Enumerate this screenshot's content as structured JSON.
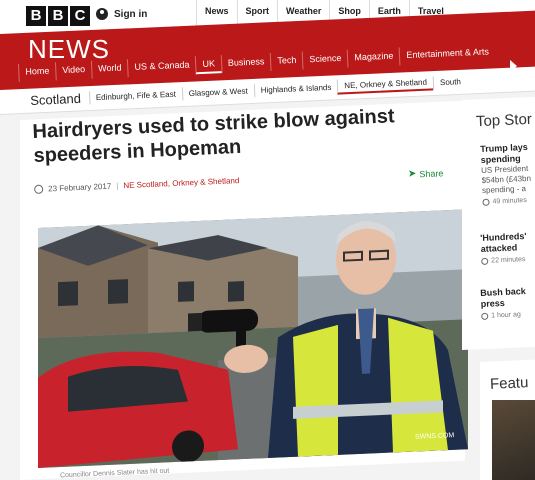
{
  "brand": {
    "letters": [
      "B",
      "B",
      "C"
    ],
    "section": "NEWS",
    "accent": "#bb1919"
  },
  "account": {
    "signin_label": "Sign in",
    "icon": "user-icon"
  },
  "top_nav": [
    "News",
    "Sport",
    "Weather",
    "Shop",
    "Earth",
    "Travel"
  ],
  "news_nav": [
    {
      "label": "Home",
      "active": false
    },
    {
      "label": "Video",
      "active": false
    },
    {
      "label": "World",
      "active": false
    },
    {
      "label": "US & Canada",
      "active": false
    },
    {
      "label": "UK",
      "active": true
    },
    {
      "label": "Business",
      "active": false
    },
    {
      "label": "Tech",
      "active": false
    },
    {
      "label": "Science",
      "active": false
    },
    {
      "label": "Magazine",
      "active": false
    },
    {
      "label": "Entertainment & Arts",
      "active": false
    }
  ],
  "sub_nav": {
    "region": "Scotland",
    "items": [
      {
        "label": "Edinburgh, Fife & East",
        "active": false
      },
      {
        "label": "Glasgow & West",
        "active": false
      },
      {
        "label": "Highlands & Islands",
        "active": false
      },
      {
        "label": "NE, Orkney & Shetland",
        "active": true
      },
      {
        "label": "South",
        "active": false
      }
    ]
  },
  "article": {
    "headline": "Hairdryers used to strike blow against speeders in Hopeman",
    "date": "23 February 2017",
    "separator": "|",
    "section_link": "NE Scotland, Orkney & Shetland",
    "share_label": "Share",
    "photo_credit": "SWNS.COM",
    "caption": "Councillor Dennis Slater has hit out"
  },
  "sidebar": {
    "heading": "Top Stor",
    "stories": [
      {
        "title": "Trump lays spending",
        "summary": "US President $54bn (£43bn spending - a",
        "time": "49 minutes"
      },
      {
        "title": "'Hundreds' attacked",
        "summary": "",
        "time": "22 minutes"
      },
      {
        "title": "Bush back press",
        "summary": "",
        "time": "1 hour ag"
      }
    ],
    "features_heading": "Featu"
  }
}
